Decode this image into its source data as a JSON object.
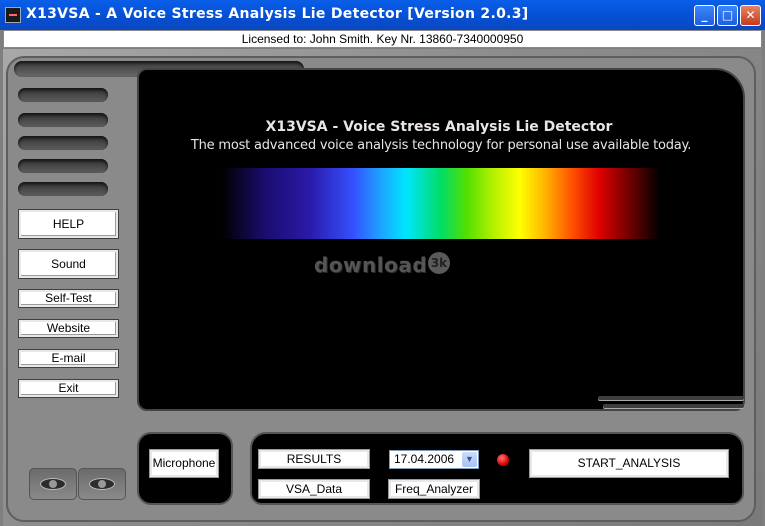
{
  "window": {
    "title": "X13VSA - A Voice Stress Analysis Lie Detector  [Version 2.0.3]",
    "minimize_glyph": "_",
    "maximize_glyph": "□",
    "close_glyph": "✕"
  },
  "license": {
    "text": "Licensed to: John Smith. Key Nr. 13860-7340000950"
  },
  "display": {
    "title": "X13VSA - Voice Stress Analysis Lie Detector",
    "subtitle": "The most advanced voice analysis technology for personal use available today.",
    "watermark": "download",
    "watermark_badge": "3k"
  },
  "sidebar": {
    "help_label": "HELP",
    "sound_label": "Sound",
    "selftest_label": "Self-Test",
    "website_label": "Website",
    "email_label": "E-mail",
    "exit_label": "Exit"
  },
  "controls": {
    "microphone_label": "Microphone",
    "results_label": "RESULTS",
    "vsa_data_label": "VSA_Data",
    "date_value": "17.04.2006",
    "freq_analyzer_label": "Freq_Analyzer",
    "start_analysis_label": "START_ANALYSIS",
    "status_led_color": "#e00000"
  },
  "icons": {
    "app": "app-icon",
    "dropdown": "▼",
    "eyes": "eye-icon"
  }
}
